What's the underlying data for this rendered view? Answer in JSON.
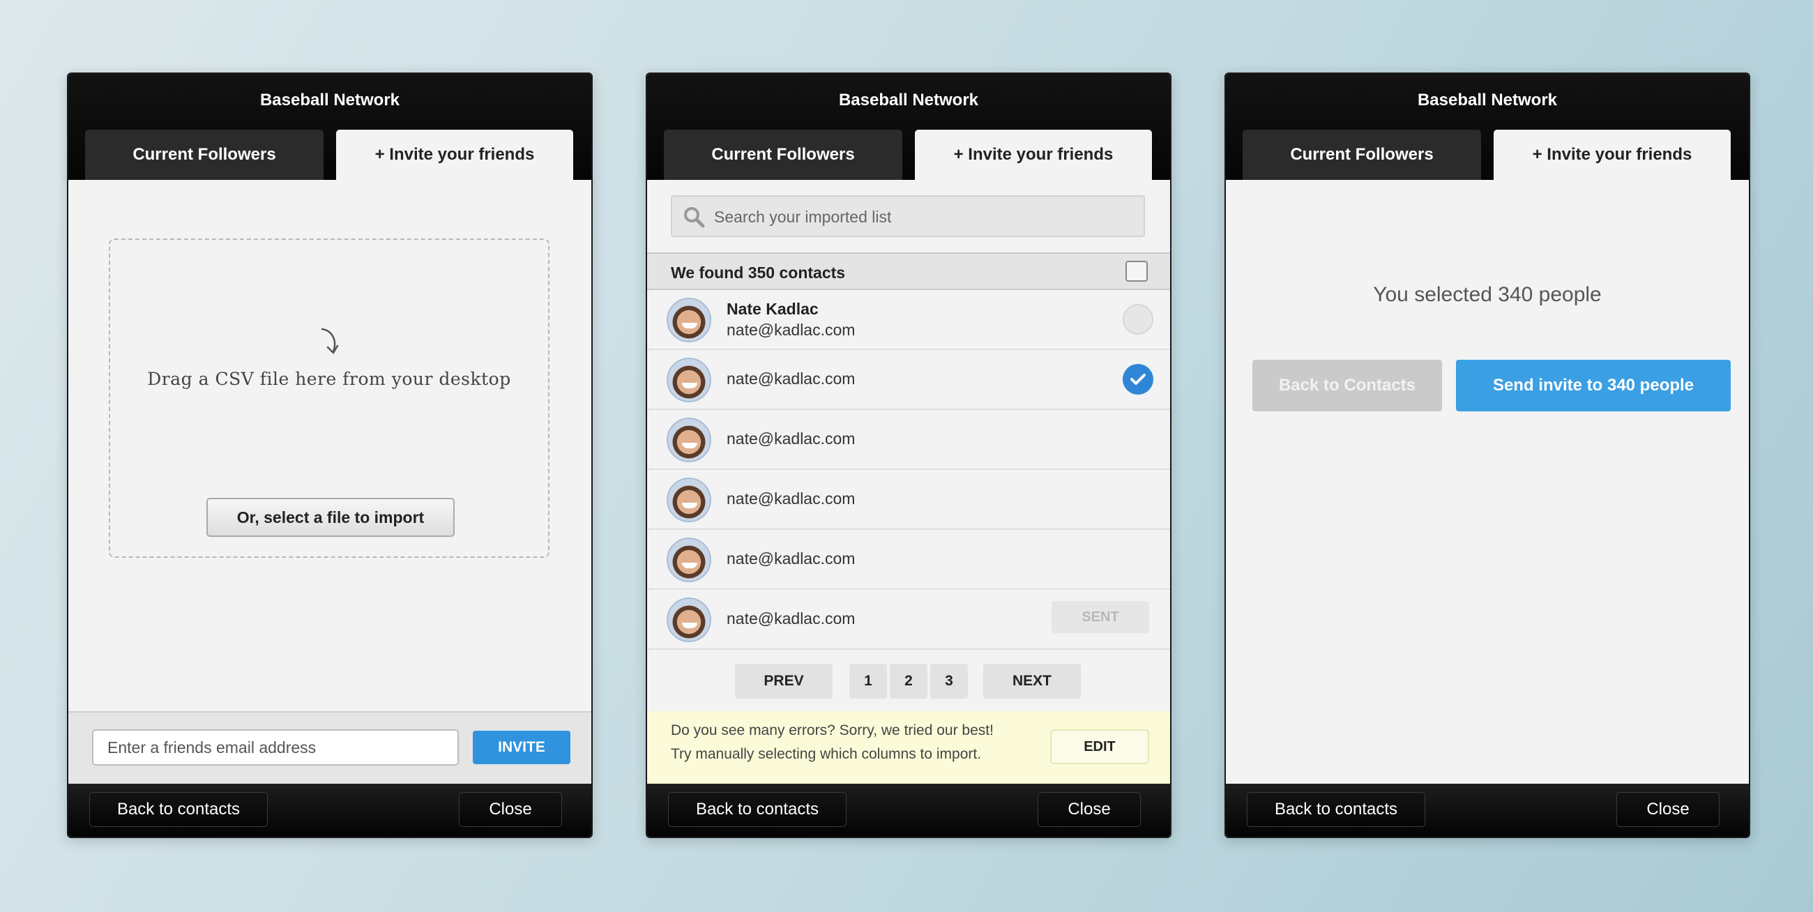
{
  "panels": [
    {
      "header": {
        "title": "Baseball Network"
      },
      "tabs": [
        {
          "label": "Current Followers"
        },
        {
          "label": "+ Invite your friends"
        }
      ],
      "dropzone": {
        "text": "Drag a CSV file here from your desktop",
        "select_label": "Or, select a file to import"
      },
      "invite": {
        "placeholder": "Enter a friends email address",
        "button_label": "INVITE"
      },
      "footer": {
        "back_label": "Back to contacts",
        "close_label": "Close"
      }
    },
    {
      "header": {
        "title": "Baseball Network"
      },
      "tabs": [
        {
          "label": "Current Followers"
        },
        {
          "label": "+ Invite your friends"
        }
      ],
      "search": {
        "placeholder": "Search your imported list"
      },
      "found_text": "We found 350 contacts",
      "contacts": [
        {
          "name": "Nate Kadlac",
          "email": "nate@kadlac.com",
          "state": "unchecked"
        },
        {
          "email": "nate@kadlac.com",
          "state": "checked"
        },
        {
          "email": "nate@kadlac.com"
        },
        {
          "email": "nate@kadlac.com"
        },
        {
          "email": "nate@kadlac.com"
        },
        {
          "email": "nate@kadlac.com",
          "state": "sent",
          "sent_label": "SENT"
        }
      ],
      "pager": {
        "prev": "PREV",
        "pages": [
          "1",
          "2",
          "3"
        ],
        "next": "NEXT"
      },
      "error": {
        "line1": "Do you see many errors? Sorry, we tried our best!",
        "line2": "Try manually selecting which columns to import.",
        "edit_label": "EDIT"
      },
      "footer": {
        "back_label": "Back to contacts",
        "close_label": "Close"
      }
    },
    {
      "header": {
        "title": "Baseball Network"
      },
      "tabs": [
        {
          "label": "Current Followers"
        },
        {
          "label": "+ Invite your friends"
        }
      ],
      "selected_text": "You selected 340 people",
      "back_button": "Back to Contacts",
      "send_button": "Send invite to 340 people",
      "footer": {
        "back_label": "Back to contacts",
        "close_label": "Close"
      }
    }
  ],
  "colors": {
    "accent": "#3093dd",
    "header": "#0b0b0b",
    "panel_bg": "#f3f3f3",
    "error_bg": "#fbfbd9"
  }
}
